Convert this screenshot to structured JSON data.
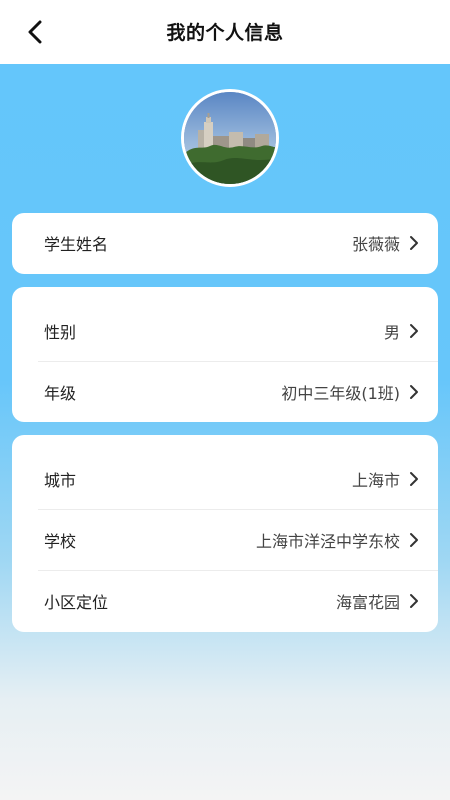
{
  "header": {
    "title": "我的个人信息"
  },
  "icons": {
    "back": "back-arrow-icon",
    "chevron": "chevron-right-icon",
    "avatar": "profile-photo"
  },
  "colors": {
    "background_top": "#63c6fb",
    "card": "#ffffff",
    "header": "#ffffff"
  },
  "profile": {
    "name_label": "学生姓名",
    "name_value": "张薇薇"
  },
  "basic": [
    {
      "label": "性别",
      "value": "男"
    },
    {
      "label": "年级",
      "value": "初中三年级(1班)"
    }
  ],
  "location": [
    {
      "label": "城市",
      "value": "上海市"
    },
    {
      "label": "学校",
      "value": "上海市洋泾中学东校"
    },
    {
      "label": "小区定位",
      "value": "海富花园"
    }
  ]
}
